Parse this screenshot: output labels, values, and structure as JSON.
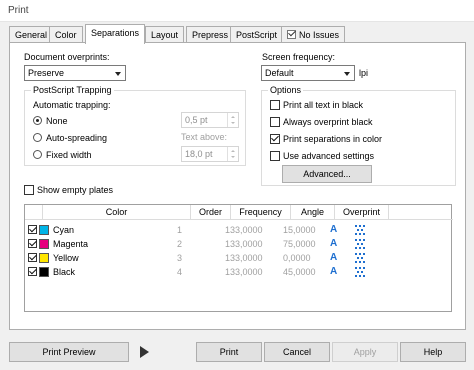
{
  "window": {
    "title": "Print"
  },
  "tabs": [
    {
      "label": "General"
    },
    {
      "label": "Color"
    },
    {
      "label": "Separations"
    },
    {
      "label": "Layout"
    },
    {
      "label": "Prepress"
    },
    {
      "label": "PostScript"
    },
    {
      "label": "No Issues"
    }
  ],
  "document_overprints": {
    "label": "Document overprints:",
    "value": "Preserve"
  },
  "screen_frequency": {
    "label": "Screen frequency:",
    "value": "Default",
    "unit": "lpi"
  },
  "trapping": {
    "group_label": "PostScript Trapping",
    "automatic_label": "Automatic trapping:",
    "options": [
      {
        "label": "None",
        "selected": true
      },
      {
        "label": "Auto-spreading",
        "selected": false
      },
      {
        "label": "Fixed width",
        "selected": false
      }
    ],
    "spread_value": "0,5 pt",
    "text_above_label": "Text above:",
    "text_above_value": "18,0 pt"
  },
  "options": {
    "group_label": "Options",
    "items": [
      {
        "label": "Print all text in black",
        "checked": false
      },
      {
        "label": "Always overprint black",
        "checked": false
      },
      {
        "label": "Print separations in color",
        "checked": true
      },
      {
        "label": "Use advanced settings",
        "checked": false
      }
    ],
    "advanced_button": "Advanced..."
  },
  "show_empty_plates": {
    "label": "Show empty plates",
    "checked": false
  },
  "table": {
    "headers": [
      "Color",
      "Order",
      "Frequency",
      "Angle",
      "Overprint"
    ],
    "rows": [
      {
        "checked": true,
        "swatch": "#00b4e6",
        "color": "Cyan",
        "order": "1",
        "frequency": "133,0000",
        "angle": "15,0000"
      },
      {
        "checked": true,
        "swatch": "#e6007e",
        "color": "Magenta",
        "order": "2",
        "frequency": "133,0000",
        "angle": "75,0000"
      },
      {
        "checked": true,
        "swatch": "#ffe600",
        "color": "Yellow",
        "order": "3",
        "frequency": "133,0000",
        "angle": "0,0000"
      },
      {
        "checked": true,
        "swatch": "#000000",
        "color": "Black",
        "order": "4",
        "frequency": "133,0000",
        "angle": "45,0000"
      }
    ],
    "overprint_icons": [
      "text-overprint-icon",
      "graphics-overprint-icon"
    ]
  },
  "buttons": {
    "print_preview": "Print Preview",
    "print": "Print",
    "cancel": "Cancel",
    "apply": "Apply",
    "help": "Help"
  },
  "colors": {
    "overprint_icon": "#1e6fd0"
  }
}
